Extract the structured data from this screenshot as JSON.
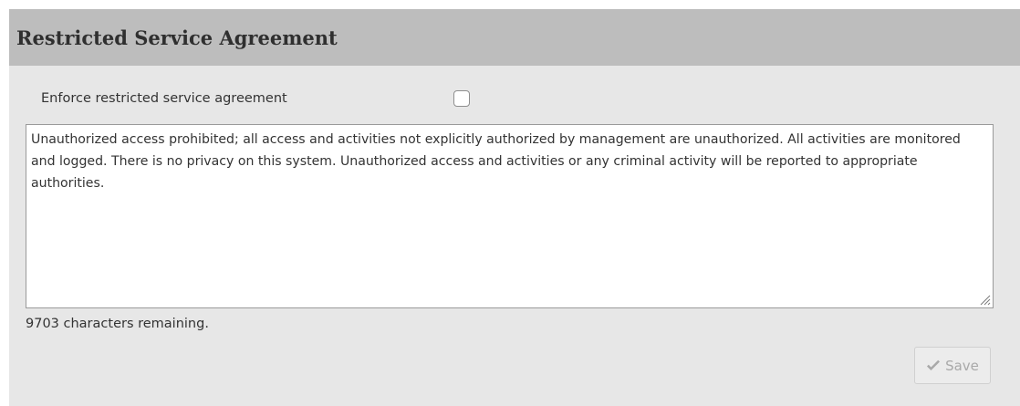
{
  "panel": {
    "title": "Restricted Service Agreement"
  },
  "enforce_option": {
    "label": "Enforce restricted service agreement",
    "checked": false
  },
  "agreement": {
    "text": "Unauthorized access prohibited; all access and activities not explicitly authorized by management are unauthorized. All activities are monitored and logged. There is no privacy on this system. Unauthorized access and activities or any criminal activity will be reported to appropriate authorities."
  },
  "status": {
    "chars_remaining": "9703 characters remaining."
  },
  "save_button": {
    "label": "Save",
    "icon": "checkmark-icon",
    "enabled": false
  },
  "colors": {
    "header_bg": "#bdbdbd",
    "panel_bg": "#e7e7e7",
    "disabled_text": "#a9a9a9"
  }
}
